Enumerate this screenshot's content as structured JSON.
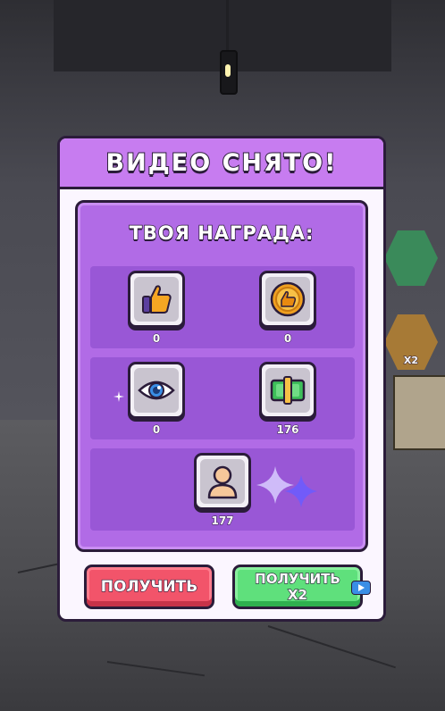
{
  "modal": {
    "title": "ВИДЕО СНЯТО!",
    "reward_heading": "ТВОЯ НАГРАДА:"
  },
  "rewards": [
    {
      "icon": "thumbs-up-icon",
      "count": "0"
    },
    {
      "icon": "thumbs-up-coin-icon",
      "count": "0"
    },
    {
      "icon": "eye-icon",
      "count": "0"
    },
    {
      "icon": "cash-icon",
      "count": "176"
    },
    {
      "icon": "subscriber-icon",
      "count": "177"
    }
  ],
  "buttons": {
    "get_label": "ПОЛУЧИТЬ",
    "get_x2_line1": "ПОЛУЧИТЬ",
    "get_x2_line2": "X2"
  },
  "side_hud": {
    "multiplier_label": "X2"
  },
  "colors": {
    "header": "#c77cf0",
    "panel": "#b16be6",
    "row": "#9957d6",
    "button_red": "#f2546a",
    "button_green": "#5fe07c",
    "outline": "#2b1c3a"
  }
}
